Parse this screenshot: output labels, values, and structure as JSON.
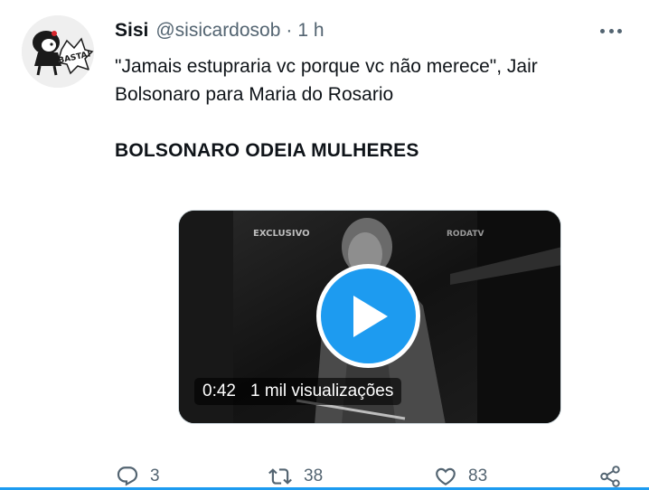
{
  "tweet": {
    "author_name": "Sisi",
    "author_handle": "@sisicardosob",
    "separator": "·",
    "time": "1 h",
    "text_lines": [
      "\"Jamais estupraria vc porque vc não merece\", Jair",
      "Bolsonaro para Maria do Rosario"
    ],
    "headline": "BOLSONARO ODEIA MULHERES",
    "avatar_label": "BASTA!"
  },
  "video": {
    "overlay_left": "EXCLUSIVO",
    "overlay_right": "RODATV",
    "duration": "0:42",
    "views": "1 mil visualizações"
  },
  "actions": {
    "replies": "3",
    "retweets": "38",
    "likes": "83"
  },
  "colors": {
    "accent": "#1d9bf0",
    "text": "#0f1419",
    "secondary": "#536471"
  },
  "icons": [
    "more-icon",
    "play-icon",
    "reply-icon",
    "retweet-icon",
    "like-icon",
    "share-icon"
  ]
}
